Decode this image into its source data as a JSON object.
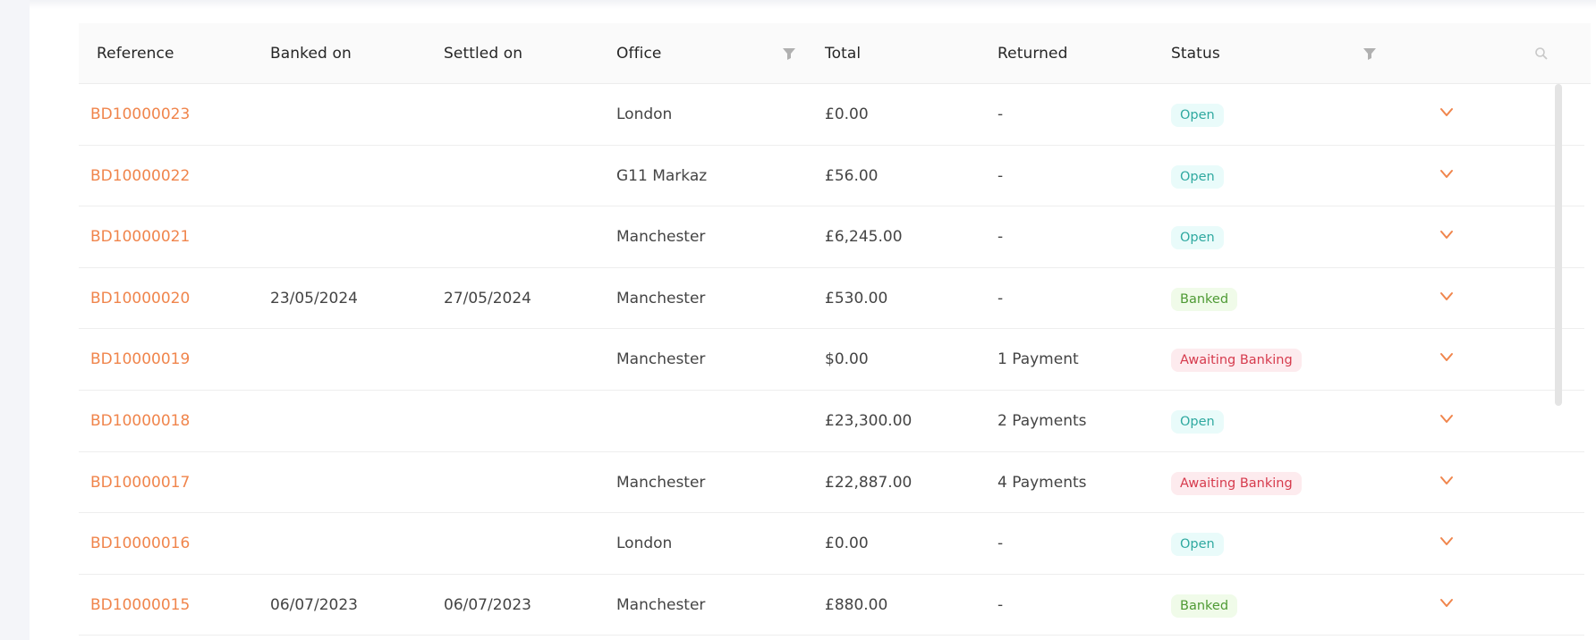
{
  "table": {
    "columns": {
      "reference": "Reference",
      "banked_on": "Banked on",
      "settled_on": "Settled on",
      "office": "Office",
      "total": "Total",
      "returned": "Returned",
      "status": "Status"
    },
    "icons": {
      "filter": "filter-icon",
      "search": "search-icon",
      "expand": "chevron-down-icon"
    },
    "colors": {
      "reference_link": "#f0854c",
      "chevron": "#f0854c",
      "status_open_text": "#2fa9a0",
      "status_open_bg": "#e9fbfa",
      "status_banked_text": "#4e9a34",
      "status_banked_bg": "#f0fbe9",
      "status_awaiting_text": "#d63b4d",
      "status_awaiting_bg": "#fdebee"
    },
    "rows": [
      {
        "reference": "BD10000023",
        "banked_on": "",
        "settled_on": "",
        "office": "London",
        "total": "£0.00",
        "returned": "-",
        "status": "Open"
      },
      {
        "reference": "BD10000022",
        "banked_on": "",
        "settled_on": "",
        "office": "G11 Markaz",
        "total": "£56.00",
        "returned": "-",
        "status": "Open"
      },
      {
        "reference": "BD10000021",
        "banked_on": "",
        "settled_on": "",
        "office": "Manchester",
        "total": "£6,245.00",
        "returned": "-",
        "status": "Open"
      },
      {
        "reference": "BD10000020",
        "banked_on": "23/05/2024",
        "settled_on": "27/05/2024",
        "office": "Manchester",
        "total": "£530.00",
        "returned": "-",
        "status": "Banked"
      },
      {
        "reference": "BD10000019",
        "banked_on": "",
        "settled_on": "",
        "office": "Manchester",
        "total": "$0.00",
        "returned": "1 Payment",
        "status": "Awaiting Banking"
      },
      {
        "reference": "BD10000018",
        "banked_on": "",
        "settled_on": "",
        "office": "",
        "total": "£23,300.00",
        "returned": "2 Payments",
        "status": "Open"
      },
      {
        "reference": "BD10000017",
        "banked_on": "",
        "settled_on": "",
        "office": "Manchester",
        "total": "£22,887.00",
        "returned": "4 Payments",
        "status": "Awaiting Banking"
      },
      {
        "reference": "BD10000016",
        "banked_on": "",
        "settled_on": "",
        "office": "London",
        "total": "£0.00",
        "returned": "-",
        "status": "Open"
      },
      {
        "reference": "BD10000015",
        "banked_on": "06/07/2023",
        "settled_on": "06/07/2023",
        "office": "Manchester",
        "total": "£880.00",
        "returned": "-",
        "status": "Banked"
      }
    ]
  }
}
